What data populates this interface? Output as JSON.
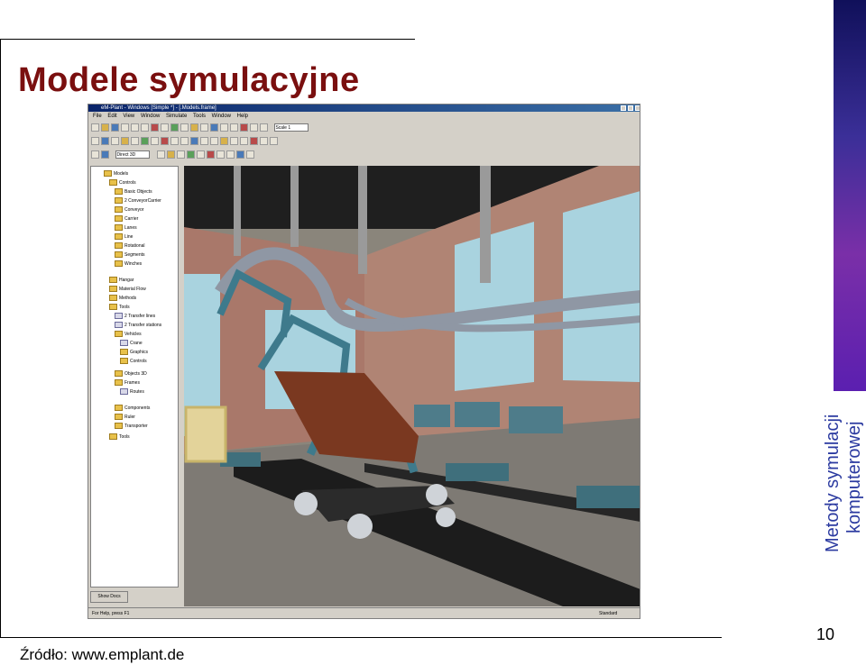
{
  "slide": {
    "title": "Modele symulacyjne",
    "source": "Źródło: www.emplant.de",
    "page_number": "10",
    "side_label_line1": "Metody symulacji",
    "side_label_line2": "komputerowej",
    "accent_color": "#7a0f0f",
    "side_text_color": "#2b3aa0"
  },
  "window": {
    "title": "eM-Plant - Windows [Simple *] - [.Models.frame]",
    "menu": [
      "File",
      "Edit",
      "View",
      "Window",
      "Simulate",
      "Tools",
      "Window",
      "Help"
    ],
    "zoom_value": "Scale 1",
    "combo_value": "Direct 3D",
    "tree_button": "Show Docs",
    "status_left": "For Help, press F1",
    "status_right": "Standard"
  },
  "tree": {
    "items": [
      "Models",
      "Controls",
      "Basic Objects",
      "2 ConveyorCarrier",
      "Conveyor",
      "Carrier",
      "Lanes",
      "Line",
      "Rotational",
      "Segments",
      "Winches",
      "Hangar",
      "Material Flow",
      "Methods",
      "Tools",
      "2 Transfer lines",
      "2 Transfer stations",
      "Vehicles",
      "Crane",
      "Graphics",
      "Controls",
      "Objects 3D",
      "Frames",
      "Routes",
      "Components",
      "Ruler",
      "Transporter",
      "Tools"
    ]
  }
}
